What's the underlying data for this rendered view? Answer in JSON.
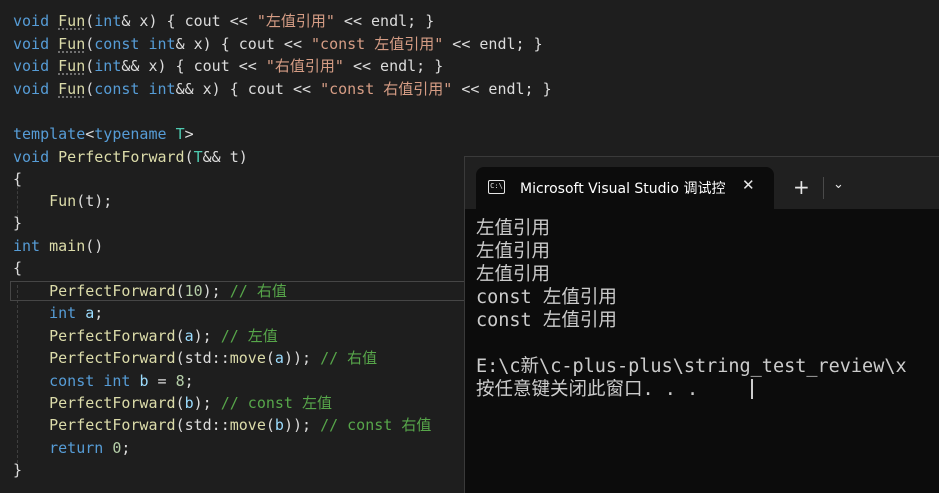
{
  "editor": {
    "l1": {
      "kw": "void",
      "fn": "Fun",
      "p1": "(",
      "t": "int",
      "p2": "& x) { cout << ",
      "s": "\"左值引用\"",
      "p3": " << endl; }"
    },
    "l2": {
      "kw": "void",
      "fn": "Fun",
      "p1": "(",
      "c": "const",
      "sp": " ",
      "t": "int",
      "p2": "& x) { cout << ",
      "s": "\"const 左值引用\"",
      "p3": " << endl; }"
    },
    "l3": {
      "kw": "void",
      "fn": "Fun",
      "p1": "(",
      "t": "int",
      "p2": "&& x) { cout << ",
      "s": "\"右值引用\"",
      "p3": " << endl; }"
    },
    "l4": {
      "kw": "void",
      "fn": "Fun",
      "p1": "(",
      "c": "const",
      "sp": " ",
      "t": "int",
      "p2": "&& x) { cout << ",
      "s": "\"const 右值引用\"",
      "p3": " << endl; }"
    },
    "l6": {
      "kw": "template",
      "p1": "<",
      "k2": "typename",
      "sp": " ",
      "ty": "T",
      "p2": ">"
    },
    "l7": {
      "kw": "void",
      "fn": "PerfectForward",
      "p1": "(",
      "ty": "T",
      "p2": "&& t)"
    },
    "l8": "{",
    "l9": {
      "fn": "Fun",
      "p1": "(t);"
    },
    "l10": "}",
    "l11": {
      "kw": "int",
      "fn": "main",
      "p1": "()"
    },
    "l12": "{",
    "l13": {
      "fn": "PerfectForward",
      "p1": "(",
      "n": "10",
      "p2": "); ",
      "cm": "// 右值"
    },
    "l14": {
      "kw": "int",
      "id": "a",
      "p1": ";"
    },
    "l15": {
      "fn": "PerfectForward",
      "p1": "(",
      "id": "a",
      "p2": "); ",
      "cm": "// 左值"
    },
    "l16": {
      "fn": "PerfectForward",
      "p1": "(std::",
      "fn2": "move",
      "p2": "(",
      "id": "a",
      "p3": ")); ",
      "cm": "// 右值"
    },
    "l17": {
      "kw": "const",
      "k2": "int",
      "id": "b",
      "p1": " = ",
      "n": "8",
      "p2": ";"
    },
    "l18": {
      "fn": "PerfectForward",
      "p1": "(",
      "id": "b",
      "p2": "); ",
      "cm": "// const 左值"
    },
    "l19": {
      "fn": "PerfectForward",
      "p1": "(std::",
      "fn2": "move",
      "p2": "(",
      "id": "b",
      "p3": ")); ",
      "cm": "// const 右值"
    },
    "l20": {
      "kw": "return",
      "n": "0",
      "p1": ";"
    },
    "l21": "}"
  },
  "terminal": {
    "tab_icon": "C:\\",
    "tab_title": "Microsoft Visual Studio 调试控",
    "close_glyph": "✕",
    "new_tab_glyph": "+",
    "dropdown_glyph": "⌄",
    "output": [
      "左值引用",
      "左值引用",
      "左值引用",
      "const 左值引用",
      "const 左值引用",
      "",
      "E:\\c新\\c-plus-plus\\string_test_review\\x",
      "按任意键关闭此窗口. . ."
    ]
  }
}
